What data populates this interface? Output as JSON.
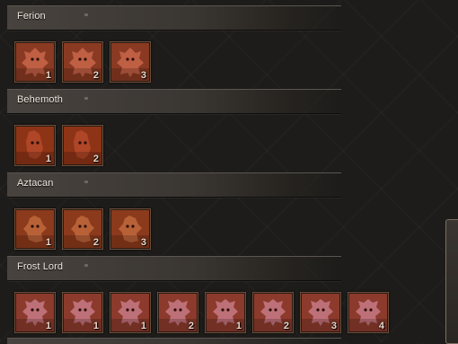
{
  "sections": [
    {
      "title": "Ferion",
      "theme": "ferion",
      "items": [
        "1",
        "2",
        "3"
      ]
    },
    {
      "title": "Behemoth",
      "theme": "behemoth",
      "items": [
        "1",
        "2"
      ]
    },
    {
      "title": "Aztacan",
      "theme": "aztacan",
      "items": [
        "1",
        "2",
        "3"
      ]
    },
    {
      "title": "Frost Lord",
      "theme": "frost",
      "items": [
        "1",
        "1",
        "1",
        "2",
        "1",
        "2",
        "3",
        "4"
      ]
    }
  ],
  "themes": {
    "ferion": {
      "bg": "#8a3a22",
      "fg": "#c8664a",
      "icon": "ferion-demon-icon"
    },
    "behemoth": {
      "bg": "#8e3416",
      "fg": "#b44a2a",
      "icon": "behemoth-icon"
    },
    "aztacan": {
      "bg": "#8b3a1c",
      "fg": "#c0683c",
      "icon": "aztacan-icon"
    },
    "frost": {
      "bg": "#8c3a2c",
      "fg": "#c77a86",
      "icon": "frost-lord-icon"
    }
  }
}
